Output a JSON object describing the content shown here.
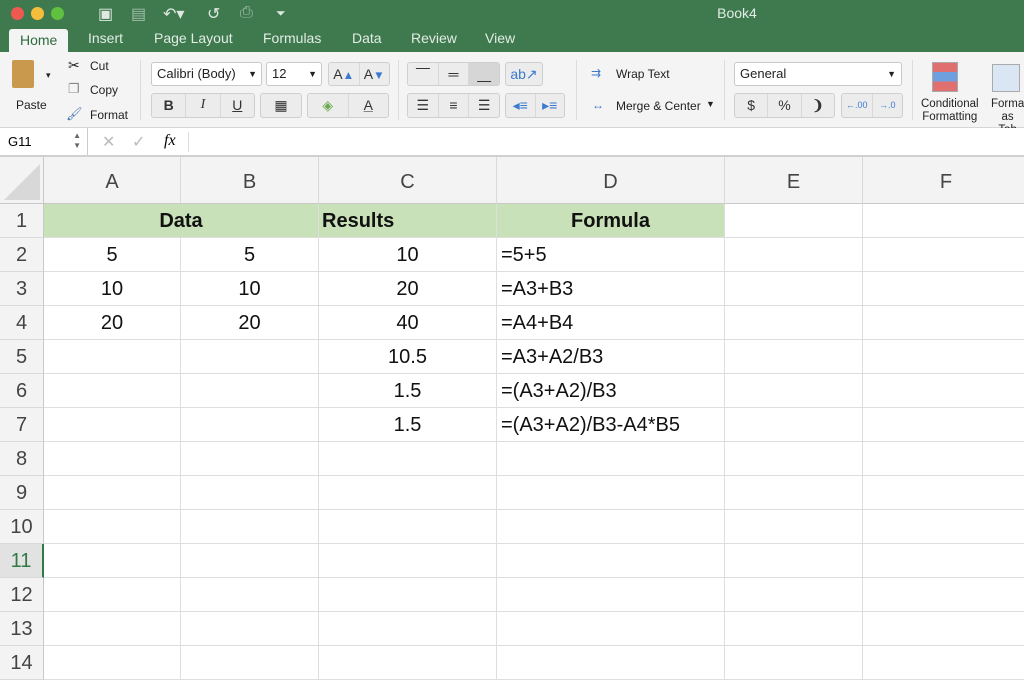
{
  "window": {
    "title": "Book4"
  },
  "tabs": [
    {
      "label": "Home",
      "active": true
    },
    {
      "label": "Insert"
    },
    {
      "label": "Page Layout"
    },
    {
      "label": "Formulas"
    },
    {
      "label": "Data"
    },
    {
      "label": "Review"
    },
    {
      "label": "View"
    }
  ],
  "ribbon": {
    "paste": "Paste",
    "cut": "Cut",
    "copy": "Copy",
    "format": "Format",
    "font": "Calibri (Body)",
    "font_size": "12",
    "bold": "B",
    "italic": "I",
    "underline": "U",
    "wrap_text": "Wrap Text",
    "merge_center": "Merge & Center",
    "number_format": "General",
    "currency": "$",
    "percent": "%",
    "comma": "❩",
    "conditional_formatting": [
      "Conditional",
      "Formatting"
    ],
    "format_as_table": [
      "Forma",
      "as Tab"
    ]
  },
  "formula_bar": {
    "name_box": "G11",
    "fx": "fx",
    "value": ""
  },
  "columns": [
    "A",
    "B",
    "C",
    "D",
    "E",
    "F"
  ],
  "rows": [
    "1",
    "2",
    "3",
    "4",
    "5",
    "6",
    "7",
    "8",
    "9",
    "10",
    "11",
    "12",
    "13",
    "14"
  ],
  "selected_row": "11",
  "header_fill": "#c9e1b8",
  "cells": {
    "header": {
      "data": "Data",
      "results": "Results",
      "formula": "Formula"
    },
    "body": [
      [
        "5",
        "5",
        "10",
        "=5+5"
      ],
      [
        "10",
        "10",
        "20",
        "=A3+B3"
      ],
      [
        "20",
        "20",
        "40",
        "=A4+B4"
      ],
      [
        "",
        "",
        "10.5",
        "=A3+A2/B3"
      ],
      [
        "",
        "",
        "1.5",
        "=(A3+A2)/B3"
      ],
      [
        "",
        "",
        "1.5",
        "=(A3+A2)/B3-A4*B5"
      ]
    ]
  }
}
